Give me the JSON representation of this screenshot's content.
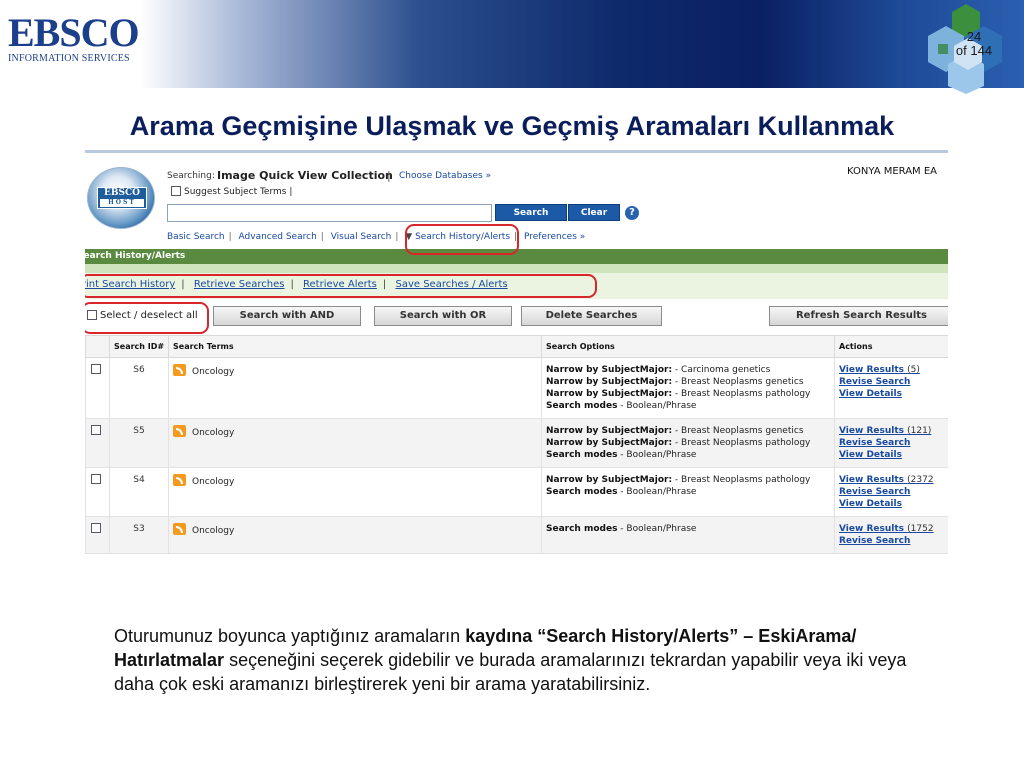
{
  "header": {
    "logo_word": "EBSCO",
    "logo_sub": "INFORMATION SERVICES",
    "page_current": "24",
    "page_total": "of 144"
  },
  "title": "Arama Geçmişine Ulaşmak ve Geçmiş Aramaları Kullanmak",
  "ebsco": {
    "logo_top": "EBSCO",
    "logo_bottom": "HOST",
    "searching_label": "Searching:",
    "collection": "Image Quick View Collection",
    "choose_databases": "Choose Databases »",
    "suggest_terms": "Suggest Subject Terms",
    "institution": "KONYA MERAM EA",
    "search_button": "Search",
    "clear_button": "Clear",
    "help_icon": "?",
    "nav": [
      "Basic Search",
      "Advanced Search",
      "Visual Search",
      "Search History/Alerts",
      "Preferences »"
    ],
    "history_bar": "Search History/Alerts",
    "history_links": [
      "Print Search History",
      "Retrieve Searches",
      "Retrieve Alerts",
      "Save Searches / Alerts"
    ],
    "select_all": "Select / deselect all",
    "buttons": [
      "Search with AND",
      "Search with OR",
      "Delete Searches",
      "Refresh Search Results"
    ],
    "columns": [
      "",
      "Search ID#",
      "Search Terms",
      "Search Options",
      "Actions"
    ],
    "rows": [
      {
        "id": "S6",
        "term": "Oncology",
        "options": [
          {
            "label": "Narrow by SubjectMajor:",
            "value": " - Carcinoma genetics"
          },
          {
            "label": "Narrow by SubjectMajor:",
            "value": " - Breast Neoplasms genetics"
          },
          {
            "label": "Narrow by SubjectMajor:",
            "value": " - Breast Neoplasms pathology"
          },
          {
            "label": "Search modes",
            "value": " - Boolean/Phrase"
          }
        ],
        "view_results": "View Results",
        "count": "(5)",
        "revise": "Revise Search",
        "details": "View Details"
      },
      {
        "id": "S5",
        "term": "Oncology",
        "options": [
          {
            "label": "Narrow by SubjectMajor:",
            "value": " - Breast Neoplasms genetics"
          },
          {
            "label": "Narrow by SubjectMajor:",
            "value": " - Breast Neoplasms pathology"
          },
          {
            "label": "Search modes",
            "value": " - Boolean/Phrase"
          }
        ],
        "view_results": "View Results",
        "count": "(121)",
        "revise": "Revise Search",
        "details": "View Details"
      },
      {
        "id": "S4",
        "term": "Oncology",
        "options": [
          {
            "label": "Narrow by SubjectMajor:",
            "value": " - Breast Neoplasms pathology"
          },
          {
            "label": "Search modes",
            "value": " - Boolean/Phrase"
          }
        ],
        "view_results": "View Results",
        "count": "(2372",
        "revise": "Revise Search",
        "details": "View Details"
      },
      {
        "id": "S3",
        "term": "Oncology",
        "options": [
          {
            "label": "Search modes",
            "value": " - Boolean/Phrase"
          }
        ],
        "view_results": "View Results",
        "count": "(1752",
        "revise": "Revise Search",
        "details": ""
      }
    ]
  },
  "caption": {
    "part1": "Oturumunuz boyunca yaptığınız aramaların ",
    "bold1": "kaydına “Search History/Alerts” – EskiArama/ Hatırlatmalar",
    "part2": " seçeneğini seçerek gidebilir ve burada aramalarınızı tekrardan yapabilir veya iki veya daha çok eski aramanızı birleştirerek yeni bir arama yaratabilirsiniz."
  },
  "colors": {
    "title": "#0a1e5c",
    "band_dark": "#0a2062",
    "history_green": "#5a8a3f",
    "highlight_red": "#d8262a",
    "link_blue": "#1a4aa0"
  }
}
